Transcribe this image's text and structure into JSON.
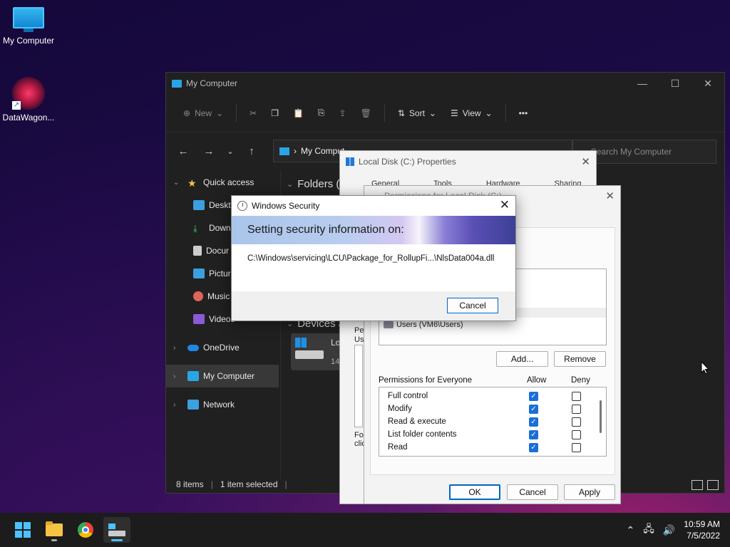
{
  "desktop": {
    "icons": [
      {
        "label": "My Computer"
      },
      {
        "label": "DataWagon..."
      }
    ]
  },
  "explorer": {
    "title": "My Computer",
    "toolbar": {
      "new_label": "New",
      "sort_label": "Sort",
      "view_label": "View",
      "more_label": "•••"
    },
    "address": {
      "location": "My Comput"
    },
    "search": {
      "placeholder": "Search My Computer"
    },
    "nav": {
      "quick_access": "Quick access",
      "items": [
        "Deskto",
        "Downl",
        "Docur",
        "Pictur",
        "Music",
        "Videos"
      ],
      "onedrive": "OneDrive",
      "my_computer": "My Computer",
      "network": "Network"
    },
    "sections": {
      "folders": "Folders (6",
      "devices": "Devices a"
    },
    "drive": {
      "name": "Lo",
      "size": "14"
    },
    "status": {
      "items": "8 items",
      "selected": "1 item selected"
    }
  },
  "properties": {
    "title": "Local Disk (C:) Properties",
    "tabs": [
      "General",
      "Tools",
      "Hardware",
      "Sharing"
    ],
    "side_text_1": "Pe",
    "side_text_2": "Us",
    "side_text_3": "For",
    "side_text_4": "clic"
  },
  "permissions": {
    "title": "Permissions for Local Disk (C:)",
    "user_row": "Users (VM6\\Users)",
    "add_label": "Add...",
    "remove_label": "Remove",
    "header": "Permissions for Everyone",
    "allow_label": "Allow",
    "deny_label": "Deny",
    "rows": [
      {
        "name": "Full control",
        "allow": true,
        "deny": false
      },
      {
        "name": "Modify",
        "allow": true,
        "deny": false
      },
      {
        "name": "Read & execute",
        "allow": true,
        "deny": false
      },
      {
        "name": "List folder contents",
        "allow": true,
        "deny": false
      },
      {
        "name": "Read",
        "allow": true,
        "deny": false
      }
    ],
    "ok_label": "OK",
    "cancel_label": "Cancel",
    "apply_label": "Apply"
  },
  "security": {
    "title": "Windows Security",
    "heading": "Setting security information on:",
    "path": "C:\\Windows\\servicing\\LCU\\Package_for_RollupFi...\\NlsData004a.dll",
    "cancel_label": "Cancel"
  },
  "taskbar": {
    "time": "10:59 AM",
    "date": "7/5/2022"
  },
  "colors": {
    "accent": "#0067c0",
    "taskbar_bg": "#1c1c1c",
    "explorer_bg": "#202020"
  }
}
